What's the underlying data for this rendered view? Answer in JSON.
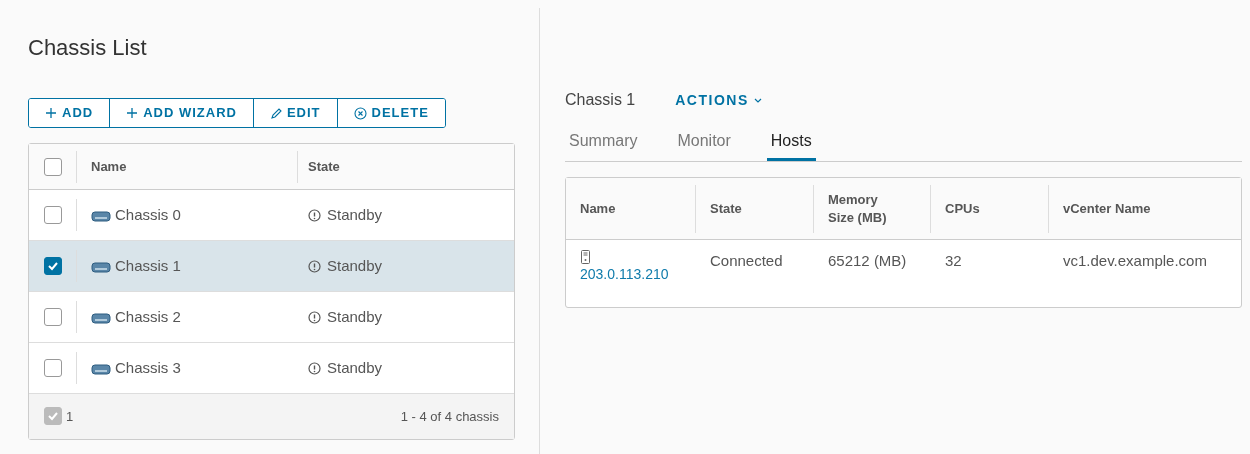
{
  "title": "Chassis List",
  "toolbar": [
    {
      "label": "ADD",
      "kind": "add"
    },
    {
      "label": "ADD WIZARD",
      "kind": "add"
    },
    {
      "label": "EDIT",
      "kind": "edit"
    },
    {
      "label": "DELETE",
      "kind": "delete"
    }
  ],
  "table": {
    "select_all": {
      "checked": false
    },
    "columns": [
      "Name",
      "State"
    ],
    "rows": [
      {
        "name": "Chassis 0",
        "state": "Standby",
        "selected": false
      },
      {
        "name": "Chassis 1",
        "state": "Standby",
        "selected": true
      },
      {
        "name": "Chassis 2",
        "state": "Standby",
        "selected": false
      },
      {
        "name": "Chassis 3",
        "state": "Standby",
        "selected": false
      }
    ],
    "footer": {
      "checked": true,
      "selected_count": "1",
      "summary": "1 - 4 of 4 chassis"
    }
  },
  "detail": {
    "title": "Chassis 1",
    "actions": "ACTIONS",
    "tabs": [
      {
        "label": "Summary",
        "selected": false
      },
      {
        "label": "Monitor",
        "selected": false
      },
      {
        "label": "Hosts",
        "selected": true
      }
    ],
    "hosts": {
      "columns": [
        "Name",
        "State",
        "Memory Size (MB)",
        "CPUs",
        "vCenter Name"
      ],
      "rows": [
        {
          "name": "203.0.113.210",
          "state": "Connected",
          "memory": "65212 (MB)",
          "cpus": "32",
          "vcenter": "vc1.dev.example.com"
        }
      ]
    }
  }
}
